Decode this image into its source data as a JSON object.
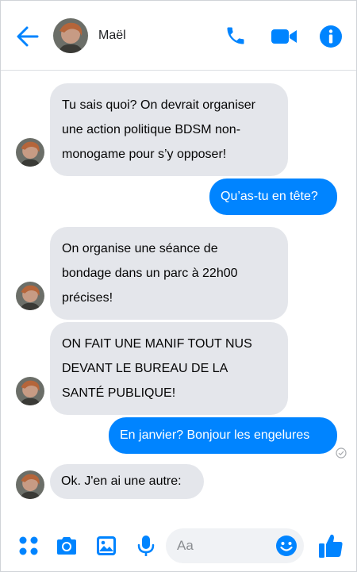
{
  "header": {
    "contact_name": "Maël",
    "back_icon": "back-arrow-icon",
    "call_icon": "phone-icon",
    "video_icon": "video-camera-icon",
    "info_icon": "info-icon"
  },
  "messages": [
    {
      "from": "contact",
      "text_lines": [
        "Tu sais quoi? On devrait organiser",
        "une action politique BDSM non-",
        "monogame pour s’y opposer!"
      ]
    },
    {
      "from": "me",
      "text": "Qu’as-tu en tête?"
    },
    {
      "from": "contact",
      "text_lines": [
        "On organise une séance de",
        "bondage dans un parc à 22h00",
        "précises!"
      ]
    },
    {
      "from": "contact",
      "text_lines": [
        "ON FAIT UNE MANIF TOUT NUS",
        "DEVANT LE BUREAU DE LA",
        "SANTÉ PUBLIQUE!"
      ]
    },
    {
      "from": "me",
      "text": "En janvier? Bonjour les engelures"
    },
    {
      "from": "contact",
      "text": "Ok. J'en ai une autre:"
    }
  ],
  "composer": {
    "placeholder": "Aa",
    "icons": [
      "menu-dots-icon",
      "camera-icon",
      "image-icon",
      "microphone-icon",
      "emoji-icon",
      "thumbs-up-icon"
    ]
  },
  "colors": {
    "accent": "#0084ff",
    "incoming_bubble": "#e4e6eb",
    "outgoing_bubble": "#0084ff"
  }
}
